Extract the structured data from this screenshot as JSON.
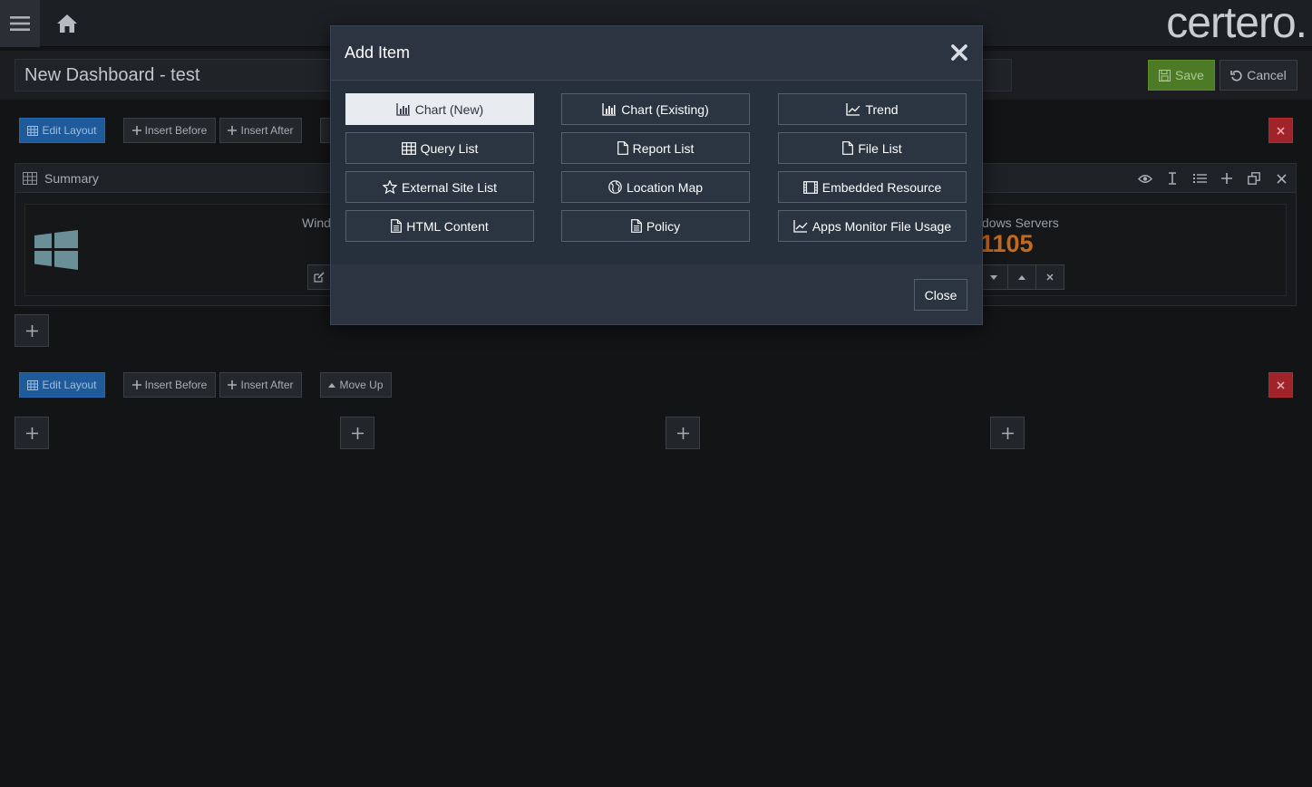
{
  "header": {
    "brand": "certero."
  },
  "dashboard": {
    "title": "New Dashboard - test",
    "save_label": "Save",
    "cancel_label": "Cancel"
  },
  "row1": {
    "edit_layout": "Edit Layout",
    "insert_before": "Insert Before",
    "insert_after": "Insert After"
  },
  "row2": {
    "edit_layout": "Edit Layout",
    "insert_before": "Insert Before",
    "insert_after": "Insert After",
    "move_up": "Move Up"
  },
  "panel": {
    "title": "Summary",
    "tile_left_label": "Wind",
    "tile_right_label": "dows Servers",
    "tile_right_value": "1105"
  },
  "modal": {
    "title": "Add Item",
    "close_label": "Close",
    "items": [
      {
        "label": "Chart (New)",
        "icon": "chart-bar-icon"
      },
      {
        "label": "Chart (Existing)",
        "icon": "chart-bar-icon"
      },
      {
        "label": "Trend",
        "icon": "trend-line-icon"
      },
      {
        "label": "Query List",
        "icon": "table-icon"
      },
      {
        "label": "Report List",
        "icon": "file-icon"
      },
      {
        "label": "File List",
        "icon": "file-icon"
      },
      {
        "label": "External Site List",
        "icon": "star-icon"
      },
      {
        "label": "Location Map",
        "icon": "globe-icon"
      },
      {
        "label": "Embedded Resource",
        "icon": "film-icon"
      },
      {
        "label": "HTML Content",
        "icon": "file-text-icon"
      },
      {
        "label": "Policy",
        "icon": "file-text-icon"
      },
      {
        "label": "Apps Monitor File Usage",
        "icon": "trend-line-icon"
      }
    ]
  },
  "colors": {
    "primary": "#1f5a9b",
    "danger": "#a0232a",
    "save": "#4d7a25",
    "accent_value": "#c6691d",
    "modal_bg": "#2c3441"
  }
}
